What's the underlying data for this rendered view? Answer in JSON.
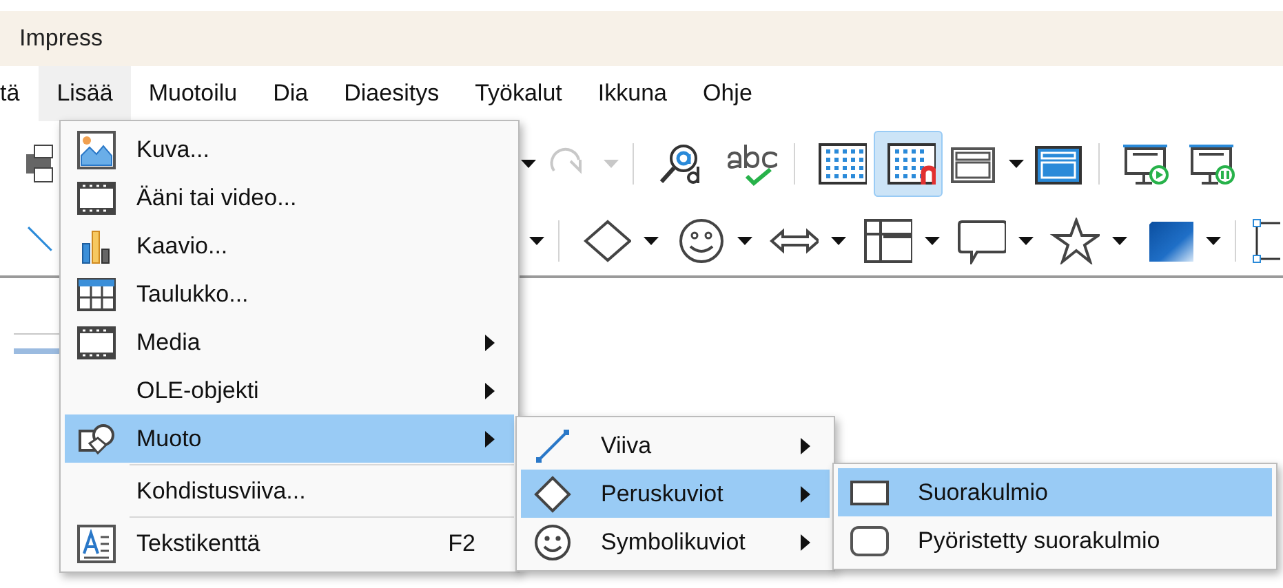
{
  "window": {
    "title": "Impress"
  },
  "menubar": [
    {
      "label": "tä",
      "selected": false
    },
    {
      "label": "Lisää",
      "selected": true
    },
    {
      "label": "Muotoilu",
      "selected": false
    },
    {
      "label": "Dia",
      "selected": false
    },
    {
      "label": "Diaesitys",
      "selected": false
    },
    {
      "label": "Työkalut",
      "selected": false
    },
    {
      "label": "Ikkuna",
      "selected": false
    },
    {
      "label": "Ohje",
      "selected": false
    }
  ],
  "toolbars": [
    {
      "buttons": [
        {
          "kind": "print"
        },
        {
          "kind": "gap"
        },
        {
          "kind": "dropdown",
          "disabled": false
        },
        {
          "kind": "redo",
          "disabled": true
        },
        {
          "kind": "dropdown",
          "disabled": true
        },
        {
          "kind": "separator"
        },
        {
          "kind": "find-replace"
        },
        {
          "kind": "spellcheck"
        },
        {
          "kind": "separator"
        },
        {
          "kind": "grid",
          "on": false
        },
        {
          "kind": "snap-grid",
          "on": true
        },
        {
          "kind": "frame"
        },
        {
          "kind": "dropdown",
          "disabled": false
        },
        {
          "kind": "filled-frame"
        },
        {
          "kind": "separator"
        },
        {
          "kind": "present-start"
        },
        {
          "kind": "present-current"
        }
      ]
    },
    {
      "buttons": [
        {
          "kind": "line"
        },
        {
          "kind": "gap"
        },
        {
          "kind": "dropdown",
          "disabled": false
        },
        {
          "kind": "separator"
        },
        {
          "kind": "diamond"
        },
        {
          "kind": "dropdown",
          "disabled": false
        },
        {
          "kind": "smiley"
        },
        {
          "kind": "dropdown",
          "disabled": false
        },
        {
          "kind": "double-arrow"
        },
        {
          "kind": "dropdown",
          "disabled": false
        },
        {
          "kind": "layout"
        },
        {
          "kind": "dropdown",
          "disabled": false
        },
        {
          "kind": "callout"
        },
        {
          "kind": "dropdown",
          "disabled": false
        },
        {
          "kind": "star"
        },
        {
          "kind": "dropdown",
          "disabled": false
        },
        {
          "kind": "cube"
        },
        {
          "kind": "dropdown",
          "disabled": false
        },
        {
          "kind": "separator"
        },
        {
          "kind": "select-box"
        }
      ]
    }
  ],
  "insert_menu": {
    "items": [
      {
        "kind": "item",
        "label": "Kuva...",
        "submenu": false,
        "selected": false
      },
      {
        "kind": "item",
        "label": "Ääni tai video...",
        "submenu": false,
        "selected": false
      },
      {
        "kind": "item",
        "label": "Kaavio...",
        "submenu": false,
        "selected": false
      },
      {
        "kind": "item",
        "label": "Taulukko...",
        "submenu": false,
        "selected": false
      },
      {
        "kind": "item",
        "label": "Media",
        "submenu": true,
        "selected": false
      },
      {
        "kind": "item",
        "label": "OLE-objekti",
        "submenu": true,
        "selected": false
      },
      {
        "kind": "item",
        "label": "Muoto",
        "submenu": true,
        "selected": true
      },
      {
        "kind": "separator"
      },
      {
        "kind": "item",
        "label": "Kohdistusviiva...",
        "submenu": false,
        "selected": false
      },
      {
        "kind": "separator"
      },
      {
        "kind": "item",
        "label": "Tekstikenttä",
        "shortcut": "F2",
        "submenu": false,
        "selected": false
      }
    ]
  },
  "shape_submenu": {
    "items": [
      {
        "kind": "item",
        "label": "Viiva",
        "submenu": true,
        "selected": false
      },
      {
        "kind": "item",
        "label": "Peruskuviot",
        "submenu": true,
        "selected": true
      },
      {
        "kind": "item",
        "label": "Symbolikuviot",
        "submenu": true,
        "selected": false
      }
    ]
  },
  "basic_shapes_submenu": {
    "items": [
      {
        "kind": "item",
        "label": "Suorakulmio",
        "submenu": false,
        "selected": true
      },
      {
        "kind": "item",
        "label": "Pyöristetty suorakulmio",
        "submenu": false,
        "selected": false
      }
    ]
  }
}
